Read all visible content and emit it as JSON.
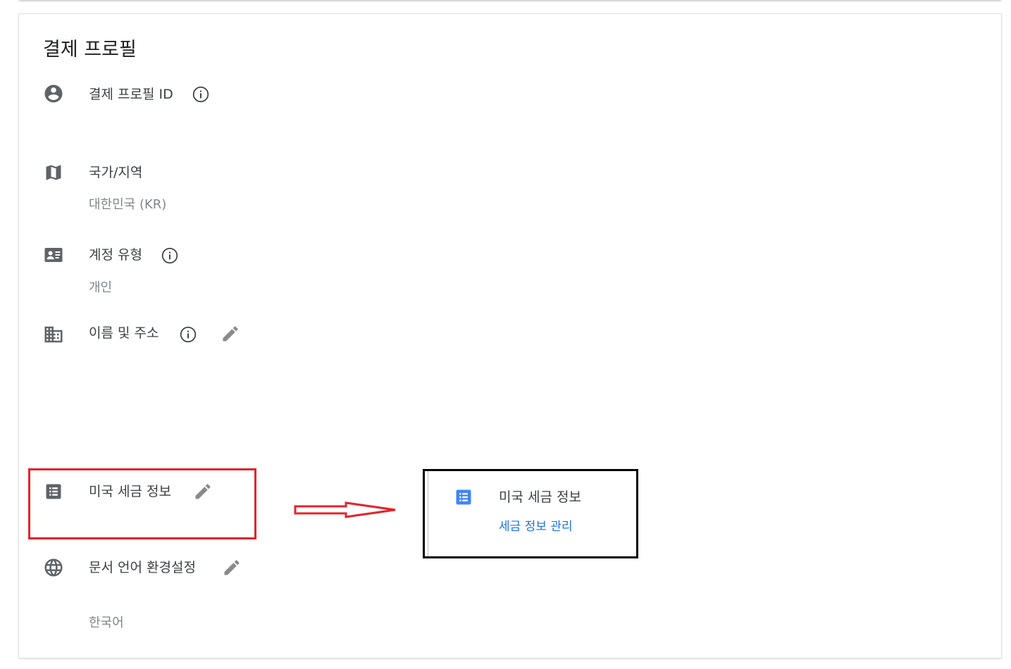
{
  "page": {
    "title": "결제 프로필"
  },
  "rows": {
    "profile_id": {
      "label": "결제 프로필 ID",
      "icon": "account-circle-icon"
    },
    "country": {
      "label": "국가/지역",
      "value": "대한민국 (KR)",
      "icon": "map-icon"
    },
    "account_type": {
      "label": "계정 유형",
      "value": "개인",
      "icon": "contact-card-icon"
    },
    "name_address": {
      "label": "이름 및 주소",
      "icon": "business-icon"
    },
    "us_tax": {
      "label": "미국 세금 정보",
      "icon": "list-alt-icon"
    },
    "doc_language": {
      "label": "문서 언어 환경설정",
      "value": "한국어",
      "icon": "globe-icon"
    }
  },
  "callout": {
    "title": "미국 세금 정보",
    "link": "세금 정보 관리",
    "icon_color": "#4285f4"
  },
  "colors": {
    "highlight_red": "#e3242b",
    "link_blue": "#1a73e8",
    "icon_gray": "#5f6368"
  }
}
